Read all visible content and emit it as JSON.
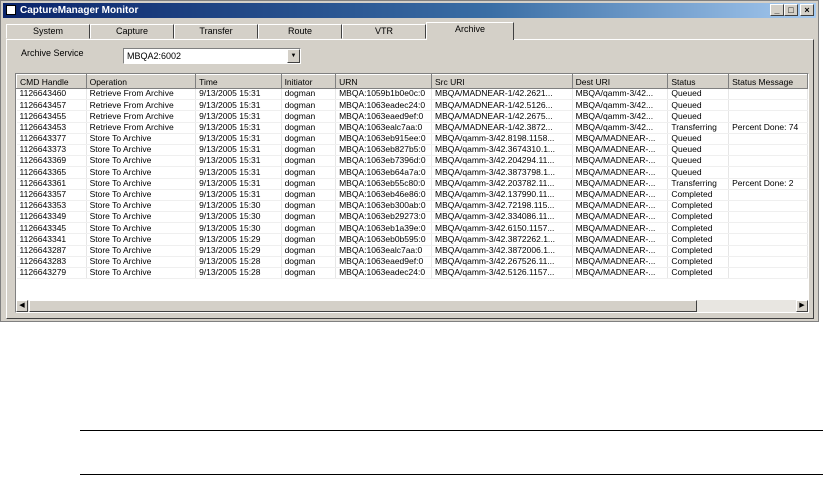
{
  "window": {
    "title": "CaptureManager Monitor",
    "min": "_",
    "max": "□",
    "close": "×"
  },
  "tabs": [
    "System",
    "Capture",
    "Transfer",
    "Route",
    "VTR",
    "Archive"
  ],
  "active_tab": "Archive",
  "archive_service": {
    "label": "Archive Service",
    "value": "MBQA2:6002",
    "arrow": "▼"
  },
  "table": {
    "columns": [
      "CMD Handle",
      "Operation",
      "Time",
      "Initiator",
      "URN",
      "Src URI",
      "Dest URI",
      "Status",
      "Status Message"
    ],
    "rows": [
      [
        "1126643460",
        "Retrieve From Archive",
        "9/13/2005 15:31",
        "dogman",
        "MBQA:1059b1b0e0c:0",
        "MBQA/MADNEAR-1/42.2621...",
        "MBQA/qamm-3/42...",
        "Queued",
        ""
      ],
      [
        "1126643457",
        "Retrieve From Archive",
        "9/13/2005 15:31",
        "dogman",
        "MBQA:1063eadec24:0",
        "MBQA/MADNEAR-1/42.5126...",
        "MBQA/qamm-3/42...",
        "Queued",
        ""
      ],
      [
        "1126643455",
        "Retrieve From Archive",
        "9/13/2005 15:31",
        "dogman",
        "MBQA:1063eaed9ef:0",
        "MBQA/MADNEAR-1/42.2675...",
        "MBQA/qamm-3/42...",
        "Queued",
        ""
      ],
      [
        "1126643453",
        "Retrieve From Archive",
        "9/13/2005 15:31",
        "dogman",
        "MBQA:1063ealc7aa:0",
        "MBQA/MADNEAR-1/42.3872...",
        "MBQA/qamm-3/42...",
        "Transferring",
        "Percent Done: 74"
      ],
      [
        "1126643377",
        "Store To Archive",
        "9/13/2005 15:31",
        "dogman",
        "MBQA:1063eb915ee:0",
        "MBQA/qamm-3/42.8198.1158...",
        "MBQA/MADNEAR-...",
        "Queued",
        ""
      ],
      [
        "1126643373",
        "Store To Archive",
        "9/13/2005 15:31",
        "dogman",
        "MBQA:1063eb827b5:0",
        "MBQA/qamm-3/42.3674310.1...",
        "MBQA/MADNEAR-...",
        "Queued",
        ""
      ],
      [
        "1126643369",
        "Store To Archive",
        "9/13/2005 15:31",
        "dogman",
        "MBQA:1063eb7396d:0",
        "MBQA/qamm-3/42.204294.11...",
        "MBQA/MADNEAR-...",
        "Queued",
        ""
      ],
      [
        "1126643365",
        "Store To Archive",
        "9/13/2005 15:31",
        "dogman",
        "MBQA:1063eb64a7a:0",
        "MBQA/qamm-3/42.3873798.1...",
        "MBQA/MADNEAR-...",
        "Queued",
        ""
      ],
      [
        "1126643361",
        "Store To Archive",
        "9/13/2005 15:31",
        "dogman",
        "MBQA:1063eb55c80:0",
        "MBQA/qamm-3/42.203782.11...",
        "MBQA/MADNEAR-...",
        "Transferring",
        "Percent Done: 2"
      ],
      [
        "1126643357",
        "Store To Archive",
        "9/13/2005 15:31",
        "dogman",
        "MBQA:1063eb46e86:0",
        "MBQA/qamm-3/42.137990.11...",
        "MBQA/MADNEAR-...",
        "Completed",
        ""
      ],
      [
        "1126643353",
        "Store To Archive",
        "9/13/2005 15:30",
        "dogman",
        "MBQA:1063eb300ab:0",
        "MBQA/qamm-3/42.72198.115...",
        "MBQA/MADNEAR-...",
        "Completed",
        ""
      ],
      [
        "1126643349",
        "Store To Archive",
        "9/13/2005 15:30",
        "dogman",
        "MBQA:1063eb29273:0",
        "MBQA/qamm-3/42.334086.11...",
        "MBQA/MADNEAR-...",
        "Completed",
        ""
      ],
      [
        "1126643345",
        "Store To Archive",
        "9/13/2005 15:30",
        "dogman",
        "MBQA:1063eb1a39e:0",
        "MBQA/qamm-3/42.6150.1157...",
        "MBQA/MADNEAR-...",
        "Completed",
        ""
      ],
      [
        "1126643341",
        "Store To Archive",
        "9/13/2005 15:29",
        "dogman",
        "MBQA:1063eb0b595:0",
        "MBQA/qamm-3/42.3872262.1...",
        "MBQA/MADNEAR-...",
        "Completed",
        ""
      ],
      [
        "1126643287",
        "Store To Archive",
        "9/13/2005 15:29",
        "dogman",
        "MBQA:1063ealc7aa:0",
        "MBQA/qamm-3/42.3872006.1...",
        "MBQA/MADNEAR-...",
        "Completed",
        ""
      ],
      [
        "1126643283",
        "Store To Archive",
        "9/13/2005 15:28",
        "dogman",
        "MBQA:1063eaed9ef:0",
        "MBQA/qamm-3/42.267526.11...",
        "MBQA/MADNEAR-...",
        "Completed",
        ""
      ],
      [
        "1126643279",
        "Store To Archive",
        "9/13/2005 15:28",
        "dogman",
        "MBQA:1063eadec24:0",
        "MBQA/qamm-3/42.5126.1157...",
        "MBQA/MADNEAR-...",
        "Completed",
        ""
      ]
    ]
  },
  "scrollbar": {
    "left_arrow": "◀",
    "right_arrow": "▶"
  }
}
